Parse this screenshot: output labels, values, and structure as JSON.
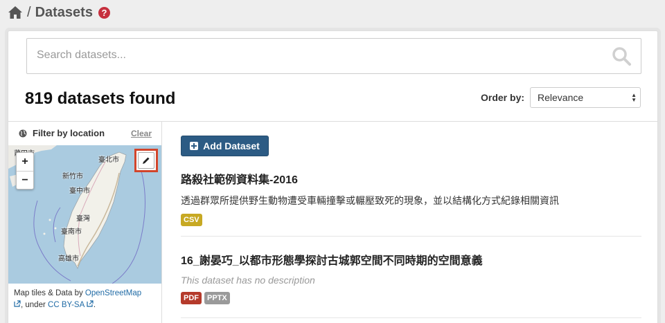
{
  "breadcrumb": {
    "home_icon": "home-icon",
    "separator": "/",
    "title": "Datasets",
    "help": "?"
  },
  "search": {
    "placeholder": "Search datasets...",
    "value": "",
    "icon": "search-icon"
  },
  "results": {
    "count_text": "819 datasets found"
  },
  "order": {
    "label": "Order by:",
    "selected": "Relevance"
  },
  "filter": {
    "title": "Filter by location",
    "clear": "Clear",
    "zoom_in": "+",
    "zoom_out": "−"
  },
  "map": {
    "labels": [
      "莆田市",
      "臺北市",
      "新竹市",
      "臺中市",
      "臺灣",
      "臺南市",
      "高雄市"
    ]
  },
  "attribution": {
    "prefix": "Map tiles & Data by",
    "osm": "OpenStreetMap",
    "under": ", under",
    "license": "CC BY-SA",
    "end": "."
  },
  "add_button": "Add Dataset",
  "datasets": [
    {
      "title": "路殺社範例資料集-2016",
      "description": "透過群眾所提供野生動物遭受車輛撞擊或輾壓致死的現象，並以結構化方式紀錄相關資訊",
      "formats": [
        "CSV"
      ]
    },
    {
      "title": "16_謝晏巧_以都市形態學探討古城郭空間不同時期的空間意義",
      "description": "This dataset has no description",
      "formats": [
        "PDF",
        "PPTX"
      ]
    }
  ],
  "colors": {
    "csv": "#c7a923",
    "pdf": "#b53a2b",
    "pptx": "#9a9a9a",
    "button": "#2c5b84",
    "highlight": "#d2452b"
  }
}
